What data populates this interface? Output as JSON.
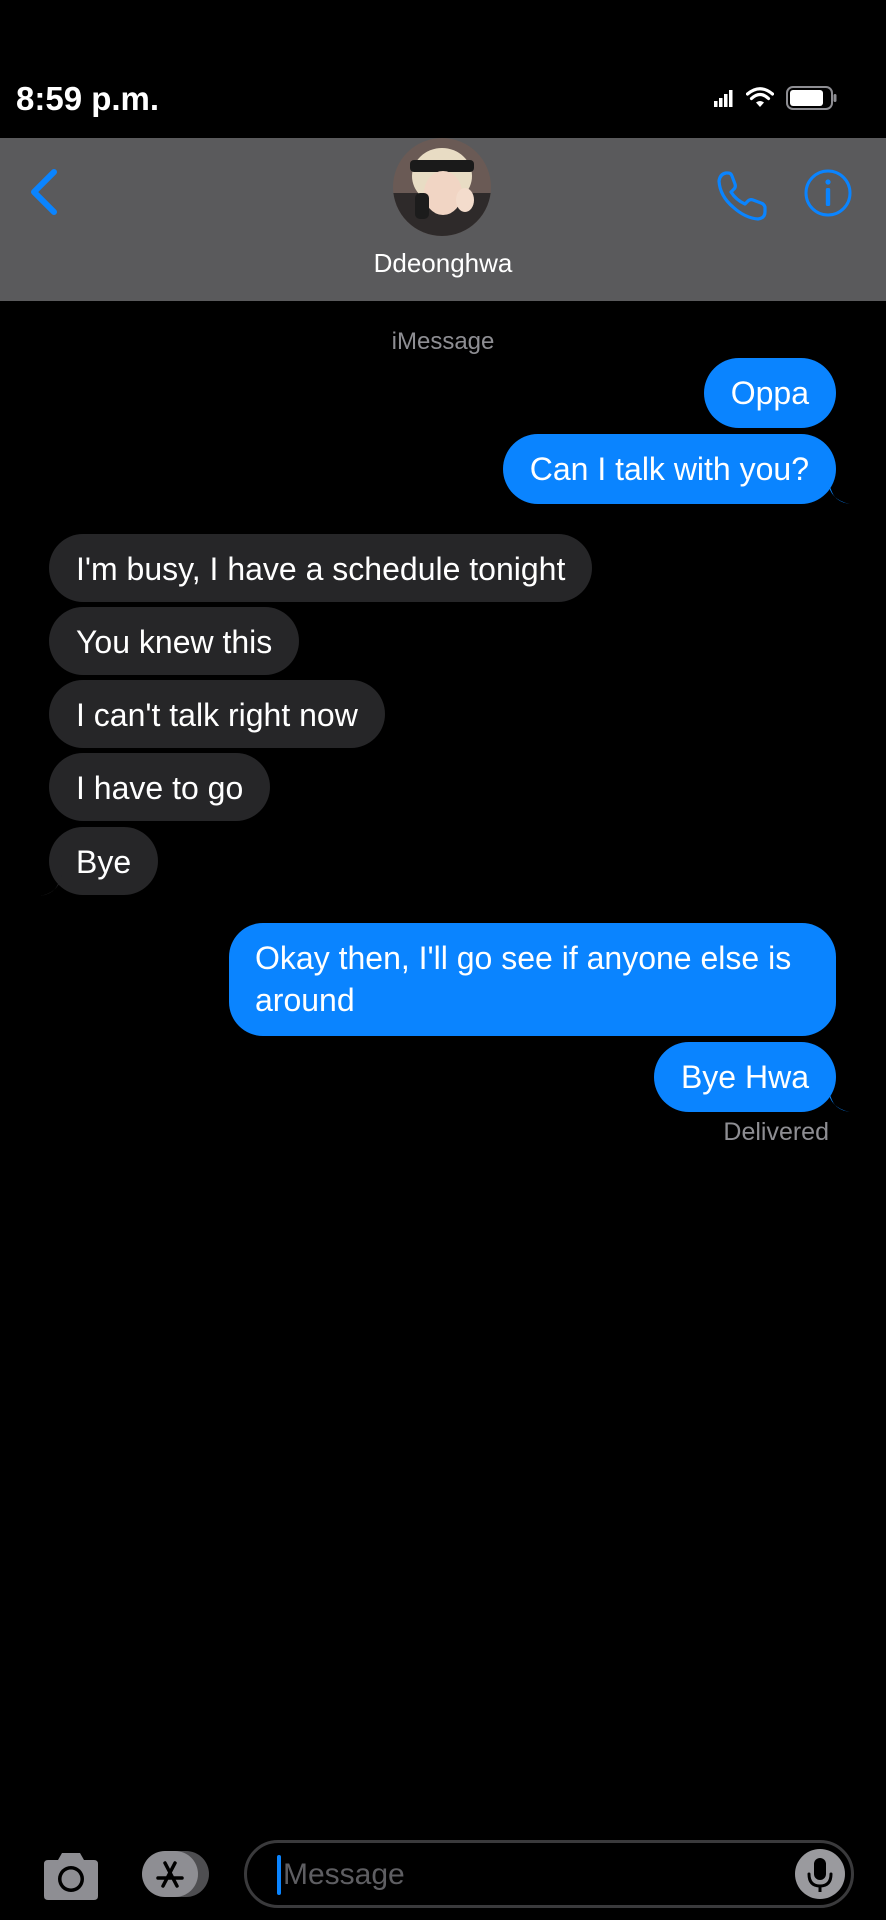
{
  "status_bar": {
    "time": "8:59 p.m.",
    "icons": [
      "signal-icon",
      "wifi-icon",
      "battery-icon"
    ]
  },
  "header": {
    "contact_name": "Ddeonghwa",
    "back_icon": "chevron-left-icon",
    "call_icon": "phone-icon",
    "info_icon": "info-icon"
  },
  "conversation": {
    "service_label": "iMessage",
    "messages": [
      {
        "from": "me",
        "text": "Oppa"
      },
      {
        "from": "me",
        "text": "Can I talk with you?"
      },
      {
        "from": "them",
        "text": "I'm busy, I have a schedule tonight"
      },
      {
        "from": "them",
        "text": "You knew this"
      },
      {
        "from": "them",
        "text": "I can't talk right now"
      },
      {
        "from": "them",
        "text": "I have to go"
      },
      {
        "from": "them",
        "text": "Bye"
      },
      {
        "from": "me",
        "text": "Okay then, I'll go see if anyone else is around"
      },
      {
        "from": "me",
        "text": "Bye Hwa"
      }
    ],
    "delivery_status": "Delivered"
  },
  "input_bar": {
    "placeholder": "Message",
    "camera_icon": "camera-icon",
    "apps_icon": "app-store-icon",
    "mic_icon": "microphone-icon"
  },
  "colors": {
    "sent_bubble": "#0a84ff",
    "received_bubble": "#262628",
    "header_bg": "#5a5a5c",
    "accent": "#0a84ff"
  }
}
